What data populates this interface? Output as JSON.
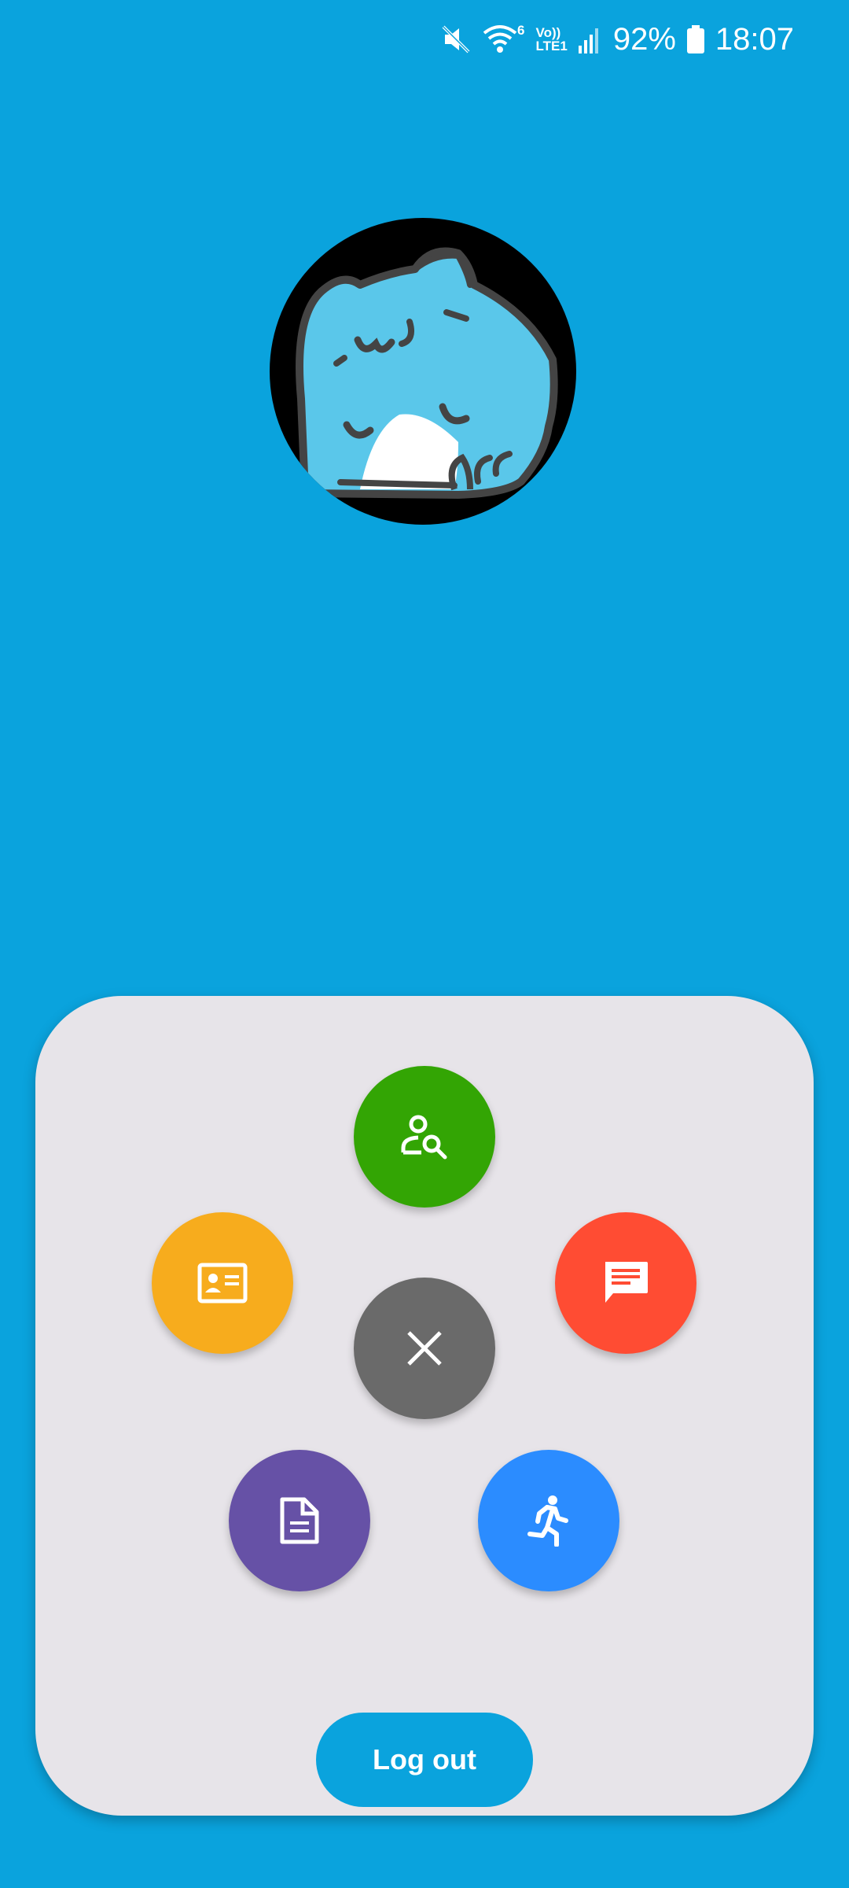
{
  "status_bar": {
    "battery_percent": "92%",
    "time": "18:07",
    "wifi_label": "6",
    "volte_label": "Vo))",
    "lte_label": "LTE1",
    "icons": [
      "mute-icon",
      "wifi-icon",
      "volte-icon",
      "signal-icon",
      "battery-icon"
    ]
  },
  "profile": {
    "avatar_icon": "blue-cat-avatar"
  },
  "menu": {
    "items": [
      {
        "name": "find-user",
        "icon": "person-search-icon",
        "color": "#33a504"
      },
      {
        "name": "profile-card",
        "icon": "id-card-icon",
        "color": "#f7ac1d"
      },
      {
        "name": "messages",
        "icon": "chat-icon",
        "color": "#ff4c33"
      },
      {
        "name": "close",
        "icon": "close-icon",
        "color": "#6a6a6a"
      },
      {
        "name": "documents",
        "icon": "document-icon",
        "color": "#6651a6"
      },
      {
        "name": "activity",
        "icon": "running-icon",
        "color": "#2b8cff"
      }
    ],
    "logout_label": "Log out"
  },
  "colors": {
    "background": "#0aa3dd",
    "card": "#e7e4e9"
  }
}
